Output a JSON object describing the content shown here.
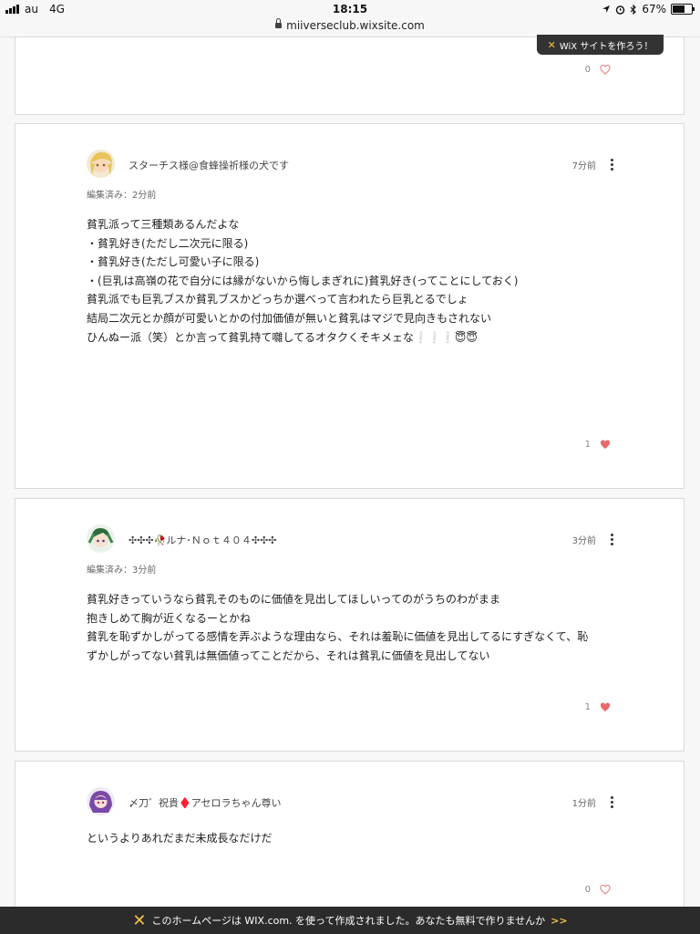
{
  "status": {
    "carrier": "au",
    "network": "4G",
    "time": "18:15",
    "url": "miiverseclub.wixsite.com",
    "battery": "67%"
  },
  "wix_pill": {
    "label": "WiX サイトを作ろう！"
  },
  "first_card": {
    "likes": "0"
  },
  "comments": [
    {
      "user": "スターチス様@食蜂操祈様の犬です",
      "time": "7分前",
      "edited": "編集済み：2分前",
      "lines": [
        "貧乳派って三種類あるんだよな",
        "",
        "・貧乳好き(ただし二次元に限る)",
        "・貧乳好き(ただし可愛い子に限る)",
        "・(巨乳は高嶺の花で自分には縁がないから悔しまぎれに)貧乳好き(ってことにしておく)",
        "",
        "貧乳派でも巨乳ブスか貧乳ブスかどっちか選べって言われたら巨乳とるでしょ",
        "結局二次元とか顔が可愛いとかの付加価値が無いと貧乳はマジで見向きもされない",
        "",
        "ひんぬー派（笑）とか言って貧乳持て囃してるオタクくそキメェな❕❕❕😇😇"
      ],
      "likes": "1",
      "liked": true
    },
    {
      "user": "✣✣✣🥀ルナ･Ｎｏｔ４０４✣✣✣",
      "time": "3分前",
      "edited": "編集済み：3分前",
      "lines": [
        "貧乳好きっていうなら貧乳そのものに価値を見出してほしいってのがうちのわがまま",
        "抱きしめて胸が近くなるーとかね",
        "貧乳を恥ずかしがってる感情を弄ぶような理由なら、それは羞恥に価値を見出してるにすぎなくて、恥",
        "ずかしがってない貧乳は無価値ってことだから、それは貧乳に価値を見出してない"
      ],
      "likes": "1",
      "liked": true
    },
    {
      "user": "〆刀゛祝貴♦️アセロラちゃん尊い",
      "time": "1分前",
      "edited": "",
      "lines": [
        "というよりあれだまだ未成長なだけだ"
      ],
      "likes": "0",
      "liked": false
    }
  ],
  "bottom_banner": {
    "text": "このホームページは WIX.com. を使って作成されました。あなたも無料で作りませんか",
    "arrows": ">>"
  },
  "colors": {
    "heart": "#e86a6a",
    "heart_outline": "#e88a8a"
  }
}
